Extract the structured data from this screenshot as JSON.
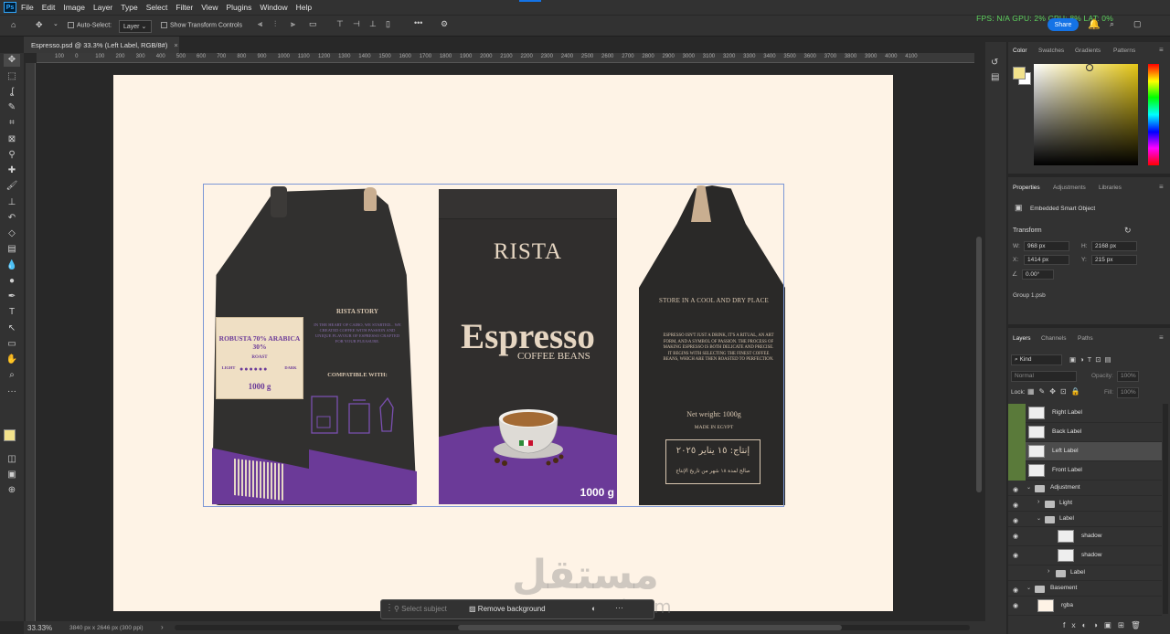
{
  "menu": {
    "logo": "Ps",
    "items": [
      "File",
      "Edit",
      "Image",
      "Layer",
      "Type",
      "Select",
      "Filter",
      "View",
      "Plugins",
      "Window",
      "Help"
    ]
  },
  "perf": "FPS: N/A GPU: 2% CPU: 8% LAT: 0%",
  "share_label": "Share",
  "options": {
    "auto_select_label": "Auto-Select:",
    "auto_select_value": "Layer",
    "transform_controls_label": "Show Transform Controls"
  },
  "document": {
    "tab_title": "Espresso.psd @ 33.3% (Left Label, RGB/8#)"
  },
  "ruler_ticks": [
    "100",
    "0",
    "100",
    "200",
    "300",
    "400",
    "500",
    "600",
    "700",
    "800",
    "900",
    "1000",
    "1100",
    "1200",
    "1300",
    "1400",
    "1500",
    "1600",
    "1700",
    "1800",
    "1900",
    "2000",
    "2100",
    "2200",
    "2300",
    "2400",
    "2500",
    "2600",
    "2700",
    "2800",
    "2900",
    "3000",
    "3100",
    "3200",
    "3300",
    "3400",
    "3500",
    "3600",
    "3700",
    "3800",
    "3900",
    "4000",
    "4100"
  ],
  "artwork": {
    "brand": "RISTA",
    "product": "Espresso",
    "subtitle": "COFFEE BEANS",
    "weight": "1000 g",
    "left_label_title": "ROBUSTA 70% ARABICA 30%",
    "left_label_roast": "ROAST",
    "left_label_light": "LIGHT",
    "left_label_dark": "DARK",
    "left_label_weight": "1000 g",
    "left_story_title": "RISTA STORY",
    "left_story_text": "IN THE HEART OF CAIRO, WE STARTED... WE CREATED COFFEE WITH PASSION AND UNIQUE FLAVOUR OF ESPRESSO CRAFTED FOR YOUR PLEASURE.",
    "compatible_title": "COMPATIBLE WITH:",
    "back_store": "STORE IN A COOL AND DRY PLACE",
    "back_text": "ESPRESSO ISN'T JUST A DRINK, IT'S A RITUAL, AN ART FORM, AND A SYMBOL OF PASSION. THE PROCESS OF MAKING ESPRESSO IS BOTH DELICATE AND PRECISE. IT BEGINS WITH SELECTING THE FINEST COFFEE BEANS, WHICH ARE THEN ROASTED TO PERFECTION.",
    "back_net_weight": "Net weight: 1000g",
    "back_made_in": "MADE IN EGYPT",
    "back_production": "إنتاج: ١٥ يناير ٢٠٢٥",
    "back_expiry": "صالح لمدة ١٨ شهر من تاريخ الإنتاج"
  },
  "status": {
    "zoom": "33.33%",
    "doc_info": "3840 px x 2646 px (300 ppi)"
  },
  "context_bar": {
    "select_subject": "Select subject",
    "remove_background": "Remove background"
  },
  "watermark": {
    "arabic": "مستقل",
    "latin": "mostaql.com"
  },
  "color_panel": {
    "tabs": [
      "Color",
      "Swatches",
      "Gradients",
      "Patterns"
    ],
    "foreground": "#f2e28c",
    "background": "#ffffff"
  },
  "properties": {
    "tabs": [
      "Properties",
      "Adjustments",
      "Libraries"
    ],
    "object_type": "Embedded Smart Object",
    "section": "Transform",
    "w_label": "W:",
    "w": "968 px",
    "h_label": "H:",
    "h": "2168 px",
    "x_label": "X:",
    "x": "1414 px",
    "y_label": "Y:",
    "y": "215 px",
    "angle": "0.00°",
    "source": "Group 1.psb"
  },
  "layers_panel": {
    "tabs": [
      "Layers",
      "Channels",
      "Paths"
    ],
    "filter_kind": "Kind",
    "blend_mode": "Normal",
    "opacity_label": "Opacity:",
    "opacity": "100%",
    "lock_label": "Lock:",
    "fill_label": "Fill:",
    "fill": "100%",
    "layers": [
      {
        "name": "Right Label",
        "type": "smart"
      },
      {
        "name": "Back Label",
        "type": "smart"
      },
      {
        "name": "Left Label",
        "type": "smart",
        "selected": true
      },
      {
        "name": "Front Label",
        "type": "smart"
      },
      {
        "name": "Adjustment",
        "type": "group"
      },
      {
        "name": "Light",
        "type": "group"
      },
      {
        "name": "Label",
        "type": "group"
      },
      {
        "name": "shadow",
        "type": "pixel"
      },
      {
        "name": "shadow",
        "type": "pixel"
      },
      {
        "name": "Label",
        "type": "group"
      },
      {
        "name": "Basement",
        "type": "group"
      },
      {
        "name": "rgba",
        "type": "pixel"
      }
    ]
  }
}
